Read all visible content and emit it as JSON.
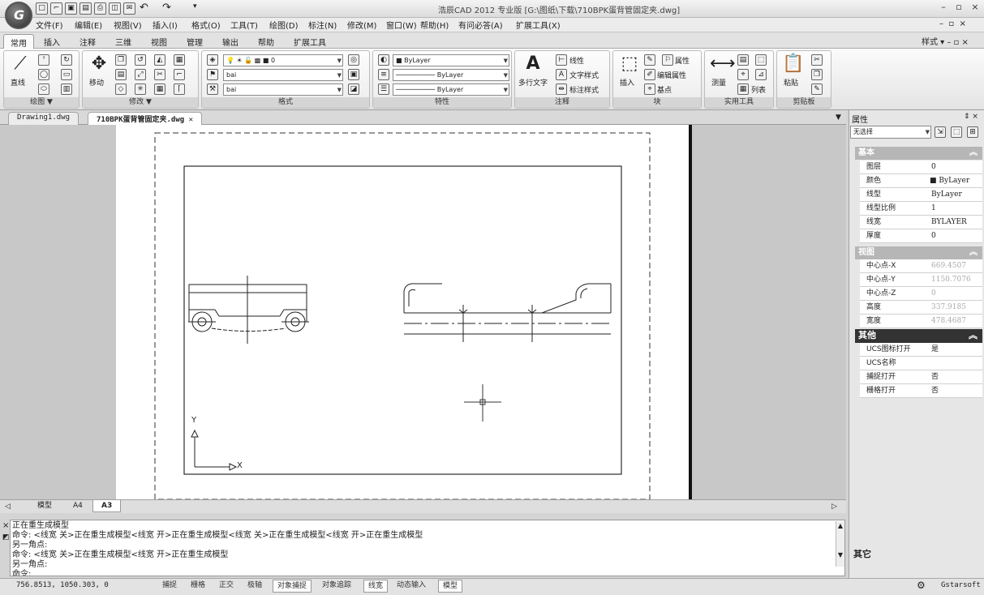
{
  "app": {
    "title": "浩辰CAD 2012 专业版   [G:\\图纸\\下载\\710BPK蛋背管固定夹.dwg]",
    "logo_glyph": "G",
    "quick_access": [
      "new-icon",
      "open-icon",
      "save-icon",
      "saveas-icon",
      "print-icon",
      "preview-icon",
      "publish-icon",
      "undo-icon",
      "redo-icon"
    ],
    "window_controls": [
      "–",
      "▫",
      "×"
    ]
  },
  "menus": [
    "文件(F)",
    "编辑(E)",
    "视图(V)",
    "插入(I)",
    "格式(O)",
    "工具(T)",
    "绘图(D)",
    "标注(N)",
    "修改(M)",
    "窗口(W)",
    "帮助(H)",
    "有问必答(A)",
    "扩展工具(X)"
  ],
  "ribbon_tabs": [
    "常用",
    "插入",
    "注释",
    "三维",
    "视图",
    "管理",
    "输出",
    "帮助",
    "扩展工具"
  ],
  "ribbon_right": "样式",
  "ribbon": {
    "draw": {
      "title": "绘图",
      "line_label": "直线"
    },
    "modify": {
      "title": "修改",
      "move_label": "移动"
    },
    "format": {
      "title": "格式",
      "layer_value": "0",
      "combo2": "bai",
      "combo3": "bai"
    },
    "properties": {
      "title": "特性",
      "color": "ByLayer",
      "linetype": "ByLayer",
      "lineweight": "ByLayer"
    },
    "annotation": {
      "title": "注释",
      "mtext_label": "多行文字",
      "b1": "线性",
      "b2": "文字样式",
      "b3": "标注样式"
    },
    "block": {
      "title": "块",
      "insert_label": "插入",
      "b1": "属性",
      "b2": "编辑属性",
      "b3": "基点"
    },
    "utilities": {
      "title": "实用工具",
      "measure_label": "测量",
      "b1": "列表"
    },
    "clipboard": {
      "title": "剪贴板",
      "paste_label": "粘贴"
    }
  },
  "doc_tabs": [
    "Drawing1.dwg",
    "710BPK蛋背管固定夹.dwg"
  ],
  "drawing": {
    "ucs_y": "Y",
    "ucs_x": "X"
  },
  "layout_tabs": [
    "模型",
    "A4",
    "A3"
  ],
  "command_lines": [
    "正在重生成模型",
    "命令: <线宽 关>正在重生成模型<线宽 开>正在重生成模型<线宽 关>正在重生成模型<线宽 开>正在重生成模型",
    "另一角点:",
    "命令: <线宽 关>正在重生成模型<线宽 开>正在重生成模型",
    "另一角点:",
    "命令:"
  ],
  "status": {
    "coords": "756.8513, 1050.303, 0",
    "buttons": [
      {
        "label": "捕捉",
        "on": false
      },
      {
        "label": "栅格",
        "on": false
      },
      {
        "label": "正交",
        "on": false
      },
      {
        "label": "极轴",
        "on": false
      },
      {
        "label": "对象捕捉",
        "on": true
      },
      {
        "label": "对象追踪",
        "on": false
      },
      {
        "label": "线宽",
        "on": true
      },
      {
        "label": "动态输入",
        "on": false
      },
      {
        "label": "模型",
        "on": true
      }
    ],
    "brand": "Gstarsoft"
  },
  "properties": {
    "panel_title": "属性",
    "selection": "无选择",
    "basic_header": "基本",
    "basic": [
      {
        "k": "图层",
        "v": "0"
      },
      {
        "k": "颜色",
        "v": "ByLayer"
      },
      {
        "k": "线型",
        "v": "ByLayer"
      },
      {
        "k": "线型比例",
        "v": "1"
      },
      {
        "k": "线宽",
        "v": "BYLAYER"
      },
      {
        "k": "厚度",
        "v": "0"
      }
    ],
    "view_header": "视图",
    "view": [
      {
        "k": "中心点-X",
        "v": "669.4507"
      },
      {
        "k": "中心点-Y",
        "v": "1150.7076"
      },
      {
        "k": "中心点-Z",
        "v": "0"
      },
      {
        "k": "高度",
        "v": "337.9185"
      },
      {
        "k": "宽度",
        "v": "478.4687"
      }
    ],
    "other_header": "其他",
    "other": [
      {
        "k": "UCS图标打开",
        "v": "是"
      },
      {
        "k": "UCS名称",
        "v": ""
      },
      {
        "k": "捕捉打开",
        "v": "否"
      },
      {
        "k": "栅格打开",
        "v": "否"
      }
    ],
    "footer": "其它"
  }
}
